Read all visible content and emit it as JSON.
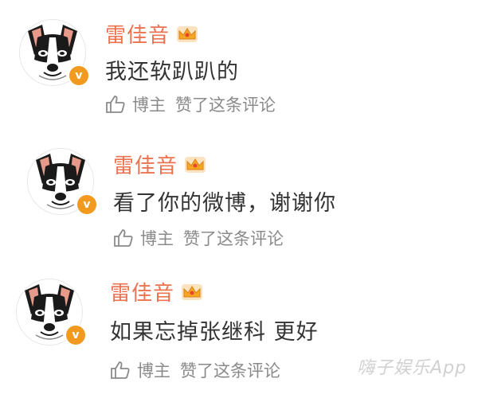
{
  "comments": [
    {
      "username": "雷佳音",
      "text": "我还软趴趴的",
      "author_label": "博主",
      "meta_label": "赞了这条评论",
      "verified_mark": "v"
    },
    {
      "username": "雷佳音",
      "text": "看了你的微博，谢谢你",
      "author_label": "博主",
      "meta_label": "赞了这条评论",
      "verified_mark": "v"
    },
    {
      "username": "雷佳音",
      "text": "如果忘掉张继科 更好",
      "author_label": "博主",
      "meta_label": "赞了这条评论",
      "verified_mark": "v"
    }
  ],
  "watermark": "嗨子娱乐App",
  "colors": {
    "username": "#eb7350",
    "comment_text": "#333333",
    "meta_text": "#8a8a8a",
    "verified_badge": "#f29a1f",
    "crown": "#f5a623"
  },
  "icons": [
    "dog-avatar",
    "verified-v-icon",
    "crown-icon",
    "thumbs-up-icon"
  ]
}
